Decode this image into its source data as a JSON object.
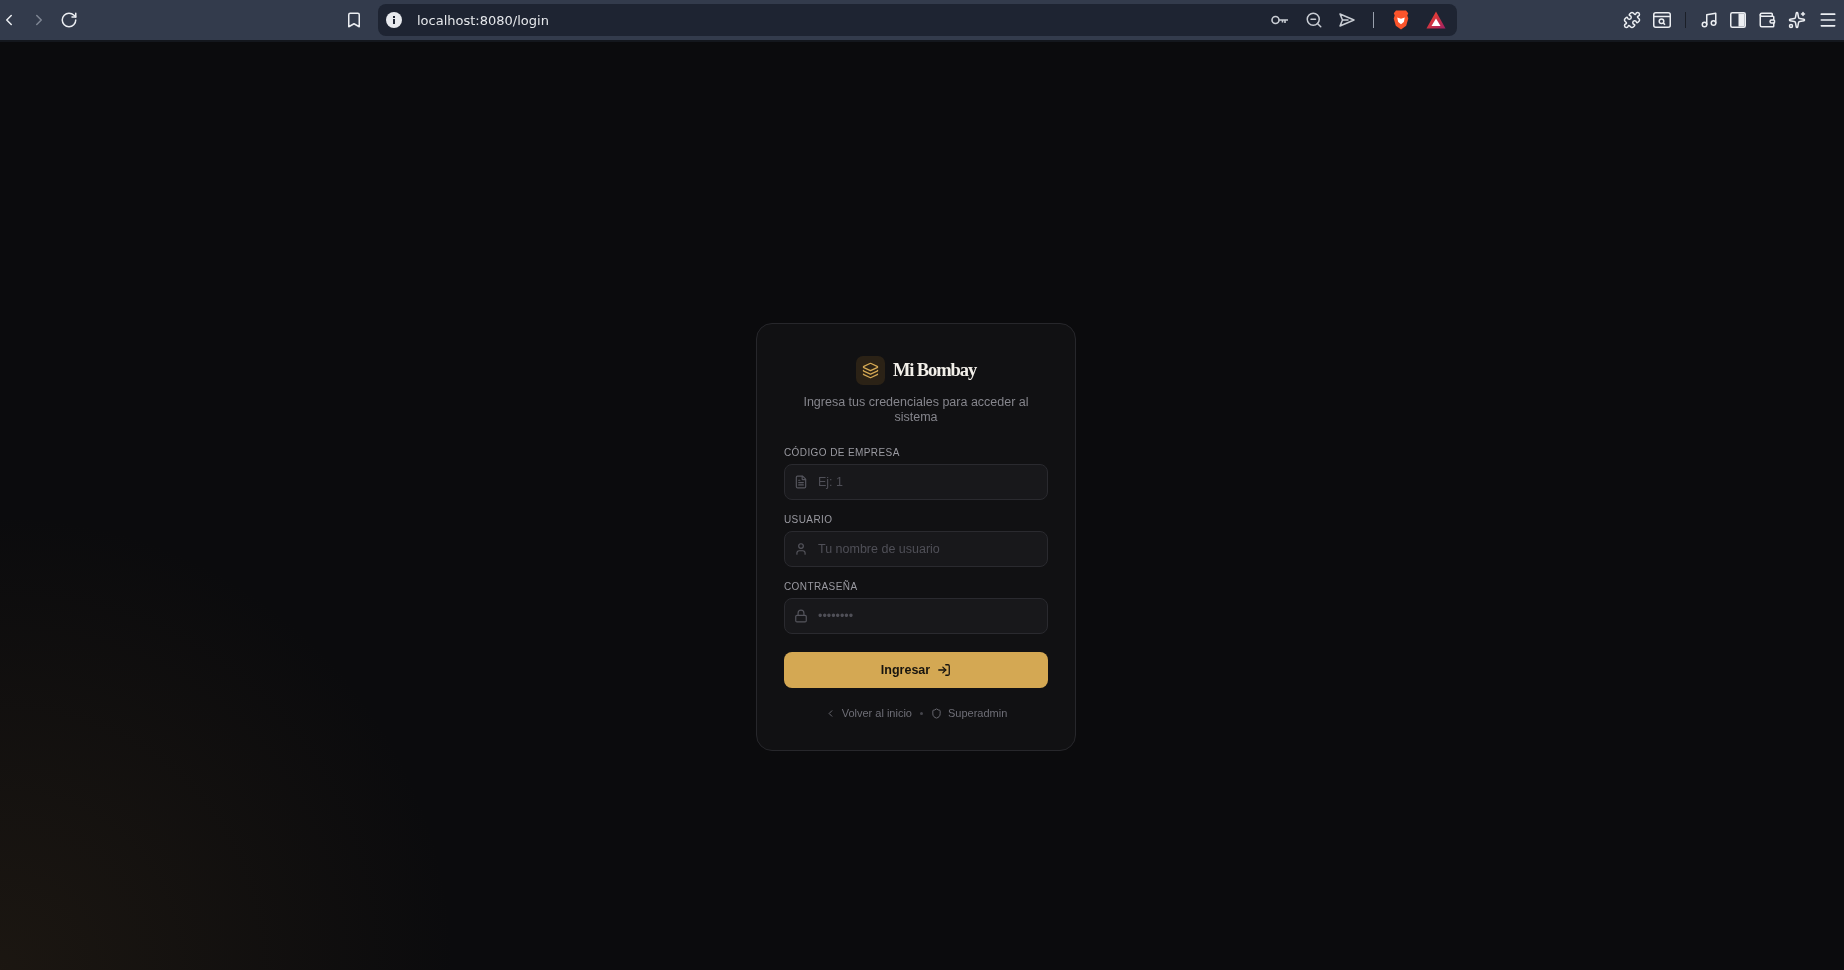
{
  "browser": {
    "back_disabled": false,
    "forward_disabled": true,
    "url": "localhost:8080/login"
  },
  "login": {
    "brand": "Mi Bombay",
    "subtitle": "Ingresa tus credenciales para acceder al sistema",
    "fields": [
      {
        "kind": "company",
        "label": "CÓDIGO DE EMPRESA",
        "placeholder": "Ej: 1"
      },
      {
        "kind": "user",
        "label": "USUARIO",
        "placeholder": "Tu nombre de usuario"
      },
      {
        "kind": "password",
        "label": "CONTRASEÑA",
        "placeholder": "••••••••"
      }
    ],
    "submit": "Ingresar",
    "links": [
      {
        "kind": "back",
        "label": "Volver al inicio"
      },
      {
        "kind": "admin",
        "label": "Superadmin"
      }
    ]
  }
}
